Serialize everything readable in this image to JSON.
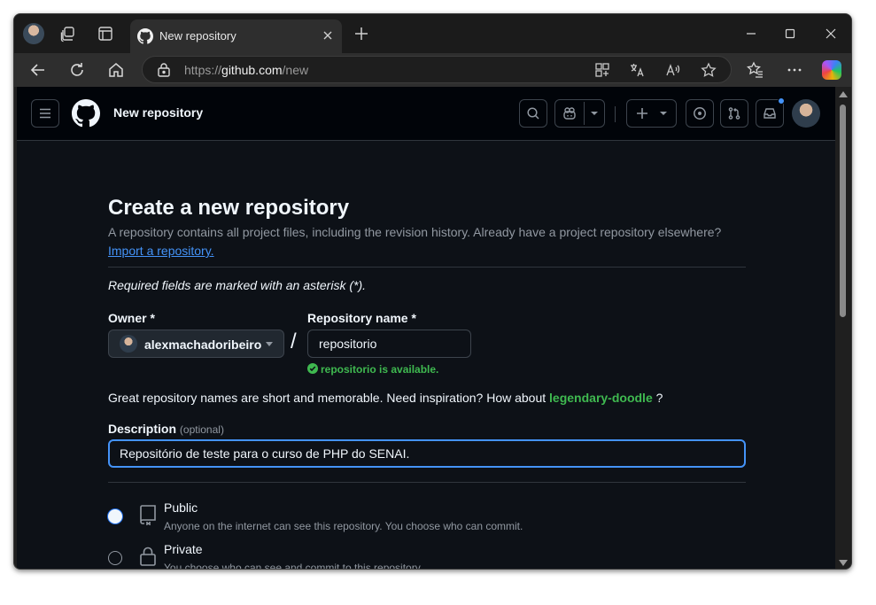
{
  "browser": {
    "tab_title": "New repository",
    "url_prefix": "https://",
    "url_host": "github.com",
    "url_path": "/new"
  },
  "header": {
    "context_title": "New repository"
  },
  "form": {
    "heading": "Create a new repository",
    "subheading": "A repository contains all project files, including the revision history. Already have a project repository elsewhere?",
    "import_link": "Import a repository.",
    "required_note": "Required fields are marked with an asterisk (*).",
    "owner_label": "Owner *",
    "owner_value": "alexmachadoribeiro",
    "slash": "/",
    "repo_label": "Repository name *",
    "repo_value": "repositorio",
    "availability": "repositorio is available.",
    "inspiration_text": "Great repository names are short and memorable. Need inspiration? How about",
    "inspiration_suggestion": "legendary-doodle",
    "inspiration_end": "?",
    "description_label": "Description",
    "description_optional": "(optional)",
    "description_value": "Repositório de teste para o curso de PHP do SENAI."
  },
  "visibility": {
    "selected": "public",
    "options": [
      {
        "title": "Public",
        "description": "Anyone on the internet can see this repository. You choose who can commit.",
        "icon": "repo-icon"
      },
      {
        "title": "Private",
        "description": "You choose who can see and commit to this repository.",
        "icon": "lock-icon"
      }
    ]
  },
  "colors": {
    "page_bg": "#0d1117",
    "header_bg": "#010409",
    "accent": "#4493f8",
    "success": "#3fb950"
  }
}
